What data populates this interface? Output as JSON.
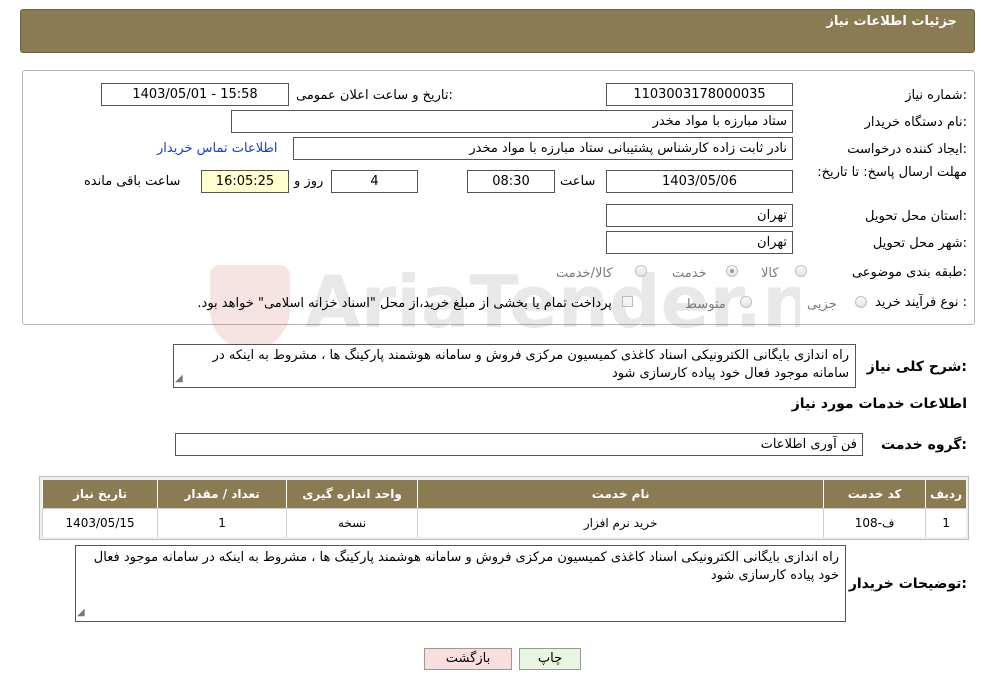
{
  "header": {
    "title": "جزئیات اطلاعات نیاز"
  },
  "form": {
    "need_number": {
      "label": "شماره نیاز:",
      "value": "1103003178000035"
    },
    "announce_datetime": {
      "label": "تاریخ و ساعت اعلان عمومی:",
      "value": "1403/05/01 - 15:58"
    },
    "buyer_org": {
      "label": "نام دستگاه خریدار:",
      "value": "ستاد مبارزه با مواد مخدر"
    },
    "requester": {
      "label": "ایجاد کننده درخواست:",
      "value": "نادر ثابت زاده کارشناس پشتیبانی ستاد مبارزه با مواد مخدر"
    },
    "buyer_contact_link": "اطلاعات تماس خریدار",
    "deadline": {
      "label": "مهلت ارسال پاسخ: تا تاریخ:",
      "date": "1403/05/06",
      "time_label": "ساعت",
      "time": "08:30",
      "days": "4",
      "days_label": "روز و",
      "remaining_time": "16:05:25",
      "remaining_label": "ساعت باقی مانده"
    },
    "delivery_province": {
      "label": "استان محل تحویل:",
      "value": "تهران"
    },
    "delivery_city": {
      "label": "شهر محل تحویل:",
      "value": "تهران"
    },
    "category": {
      "label": "طبقه بندی موضوعی:",
      "options": [
        "کالا",
        "خدمت",
        "کالا/خدمت"
      ],
      "selected": "خدمت"
    },
    "purchase_type": {
      "label": "نوع فرآیند خرید :",
      "options": [
        "جزیی",
        "متوسط"
      ],
      "note": "پرداخت تمام یا بخشی از مبلغ خرید،از محل \"اسناد خزانه اسلامی\" خواهد بود."
    }
  },
  "description": {
    "label": "شرح کلی نیاز:",
    "text": "راه اندازی بایگانی الکترونیکی اسناد کاغذی کمیسیون مرکزی فروش و سامانه هوشمند پارکینگ ها ، مشروط به اینکه در سامانه موجود فعال خود پیاده کارسازی شود"
  },
  "services_section": {
    "title": "اطلاعات خدمات مورد نیاز",
    "group_label": "گروه خدمت:",
    "group_value": "فن آوری اطلاعات",
    "table": {
      "headers": [
        "ردیف",
        "کد خدمت",
        "نام خدمت",
        "واحد اندازه گیری",
        "تعداد / مقدار",
        "تاریخ نیاز"
      ],
      "rows": [
        [
          "1",
          "ف-108",
          "خرید نرم افزار",
          "نسخه",
          "1",
          "1403/05/15"
        ]
      ]
    }
  },
  "buyer_notes": {
    "label": "توضیحات خریدار:",
    "text": "راه اندازی بایگانی الکترونیکی اسناد کاغذی کمیسیون مرکزی فروش و سامانه هوشمند پارکینگ ها ، مشروط به اینکه در سامانه موجود فعال خود پیاده کارسازی شود"
  },
  "buttons": {
    "print": "چاپ",
    "back": "بازگشت"
  },
  "watermark_text": "AriaTender.neT",
  "colors": {
    "header_bg": "#8b7b52",
    "link": "#1a3fc7",
    "back_button_bg": "#f9dede",
    "print_button_bg": "#e6f6e0"
  }
}
